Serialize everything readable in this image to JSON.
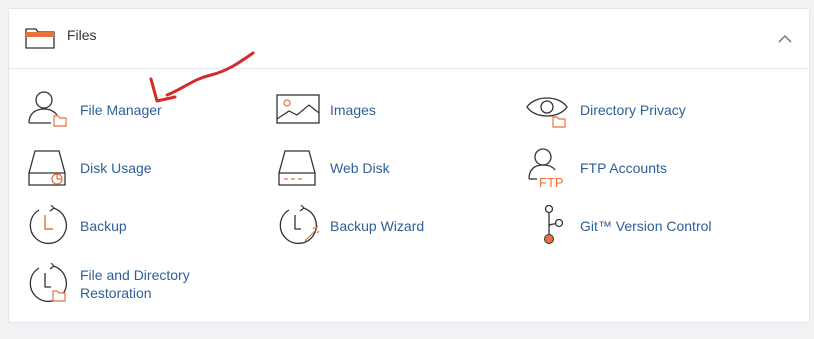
{
  "section": {
    "title": "Files",
    "title_icon": "folder-icon",
    "collapse_icon": "chevron-up-icon"
  },
  "items": [
    {
      "label": "File Manager",
      "icon": "file-manager-icon"
    },
    {
      "label": "Images",
      "icon": "images-icon"
    },
    {
      "label": "Directory Privacy",
      "icon": "directory-privacy-icon"
    },
    {
      "label": "Disk Usage",
      "icon": "disk-usage-icon"
    },
    {
      "label": "Web Disk",
      "icon": "web-disk-icon"
    },
    {
      "label": "FTP Accounts",
      "icon": "ftp-accounts-icon",
      "badge": "FTP"
    },
    {
      "label": "Backup",
      "icon": "backup-icon"
    },
    {
      "label": "Backup Wizard",
      "icon": "backup-wizard-icon"
    },
    {
      "label": "Git™ Version Control",
      "icon": "git-icon"
    },
    {
      "label_line1": "File and Directory",
      "label_line2": "Restoration",
      "icon": "file-restore-icon"
    }
  ],
  "colors": {
    "link": "#2f5f99",
    "accent": "#e8713c",
    "annotation": "#d42a2a"
  }
}
